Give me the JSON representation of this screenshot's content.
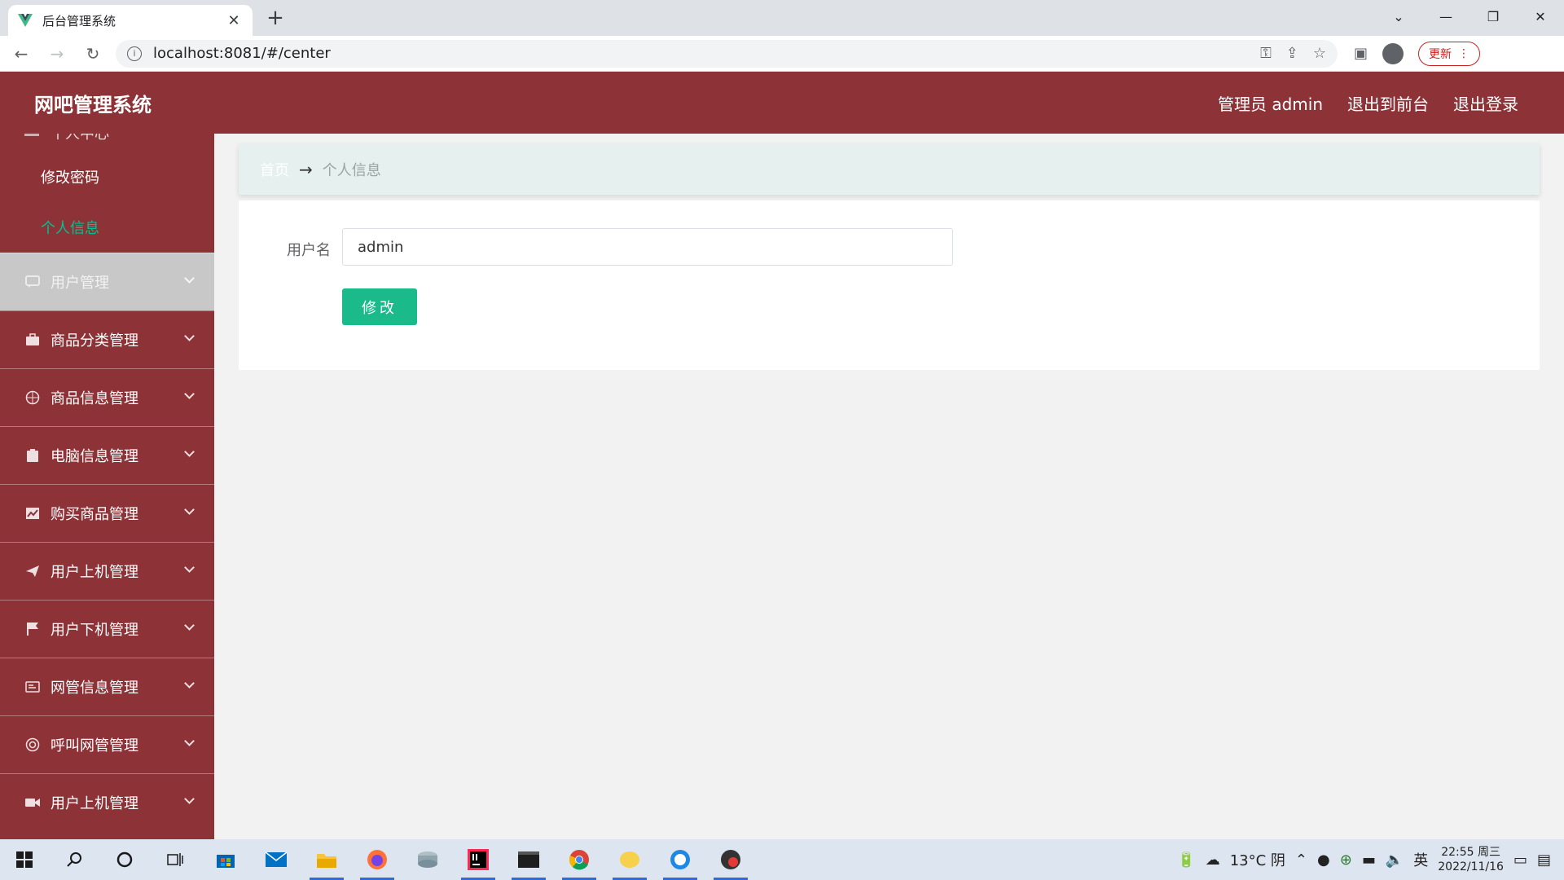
{
  "browser": {
    "tab_title": "后台管理系统",
    "url": "localhost:8081/#/center",
    "update_label": "更新"
  },
  "header": {
    "title": "网吧管理系统",
    "user": "管理员 admin",
    "to_front": "退出到前台",
    "logout": "退出登录"
  },
  "sidebar": {
    "cut_label": "个人中心",
    "sub_items": [
      {
        "label": "修改密码"
      },
      {
        "label": "个人信息"
      }
    ],
    "items": [
      {
        "label": "用户管理"
      },
      {
        "label": "商品分类管理"
      },
      {
        "label": "商品信息管理"
      },
      {
        "label": "电脑信息管理"
      },
      {
        "label": "购买商品管理"
      },
      {
        "label": "用户上机管理"
      },
      {
        "label": "用户下机管理"
      },
      {
        "label": "网管信息管理"
      },
      {
        "label": "呼叫网管管理"
      },
      {
        "label": "用户上机管理"
      }
    ]
  },
  "breadcrumb": {
    "home": "首页",
    "separator": "→",
    "current": "个人信息"
  },
  "form": {
    "username_label": "用户名",
    "username_value": "admin",
    "submit_label": "修改"
  },
  "taskbar": {
    "weather": "13°C 阴",
    "ime": "英",
    "time": "22:55 周三",
    "date": "2022/11/16"
  },
  "colors": {
    "brand": "#8d3338",
    "active": "#00c292",
    "button": "#1aba8a"
  }
}
